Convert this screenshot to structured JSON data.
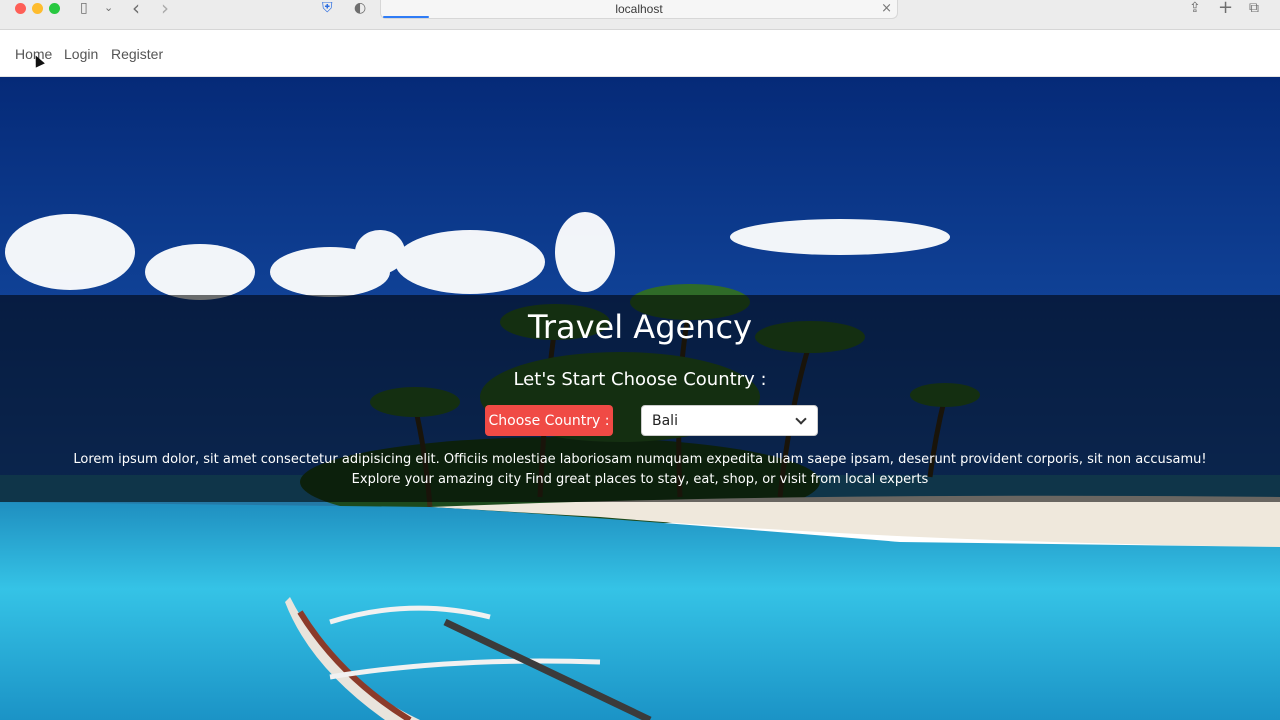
{
  "browser": {
    "url": "localhost",
    "load_progress": 0.09,
    "icons": [
      "sidebar-icon",
      "chevron-down-icon",
      "back-icon",
      "forward-icon",
      "shield-icon",
      "privacy-icon",
      "close-icon",
      "share-icon",
      "new-tab-icon",
      "tab-overview-icon"
    ],
    "glyphs": {
      "sidebar": "▯",
      "dropdown": "⌄",
      "back": "‹",
      "forward": "›",
      "shield": "⛨",
      "privacy": "◐",
      "close": "×",
      "share": "⇪",
      "new_tab": "+",
      "tabs": "⧉"
    }
  },
  "nav": {
    "links": [
      "Home",
      "Login",
      "Register"
    ]
  },
  "hero": {
    "title": "Travel Agency",
    "subtitle": "Let's Start Choose Country :",
    "choose_button": "Choose Country :",
    "selected_country": "Bali",
    "description_line1": "Lorem ipsum dolor, sit amet consectetur adipisicing elit. Officiis molestiae laboriosam numquam expedita ullam saepe ipsam, deserunt provident corporis, sit non accusamu!",
    "description_line2": "Explore your amazing city Find great places to stay, eat, shop, or visit from local experts"
  },
  "colors": {
    "accent_button": "#f04a45",
    "sky": "#0b3a8c",
    "sea": "#2cb2d8"
  }
}
